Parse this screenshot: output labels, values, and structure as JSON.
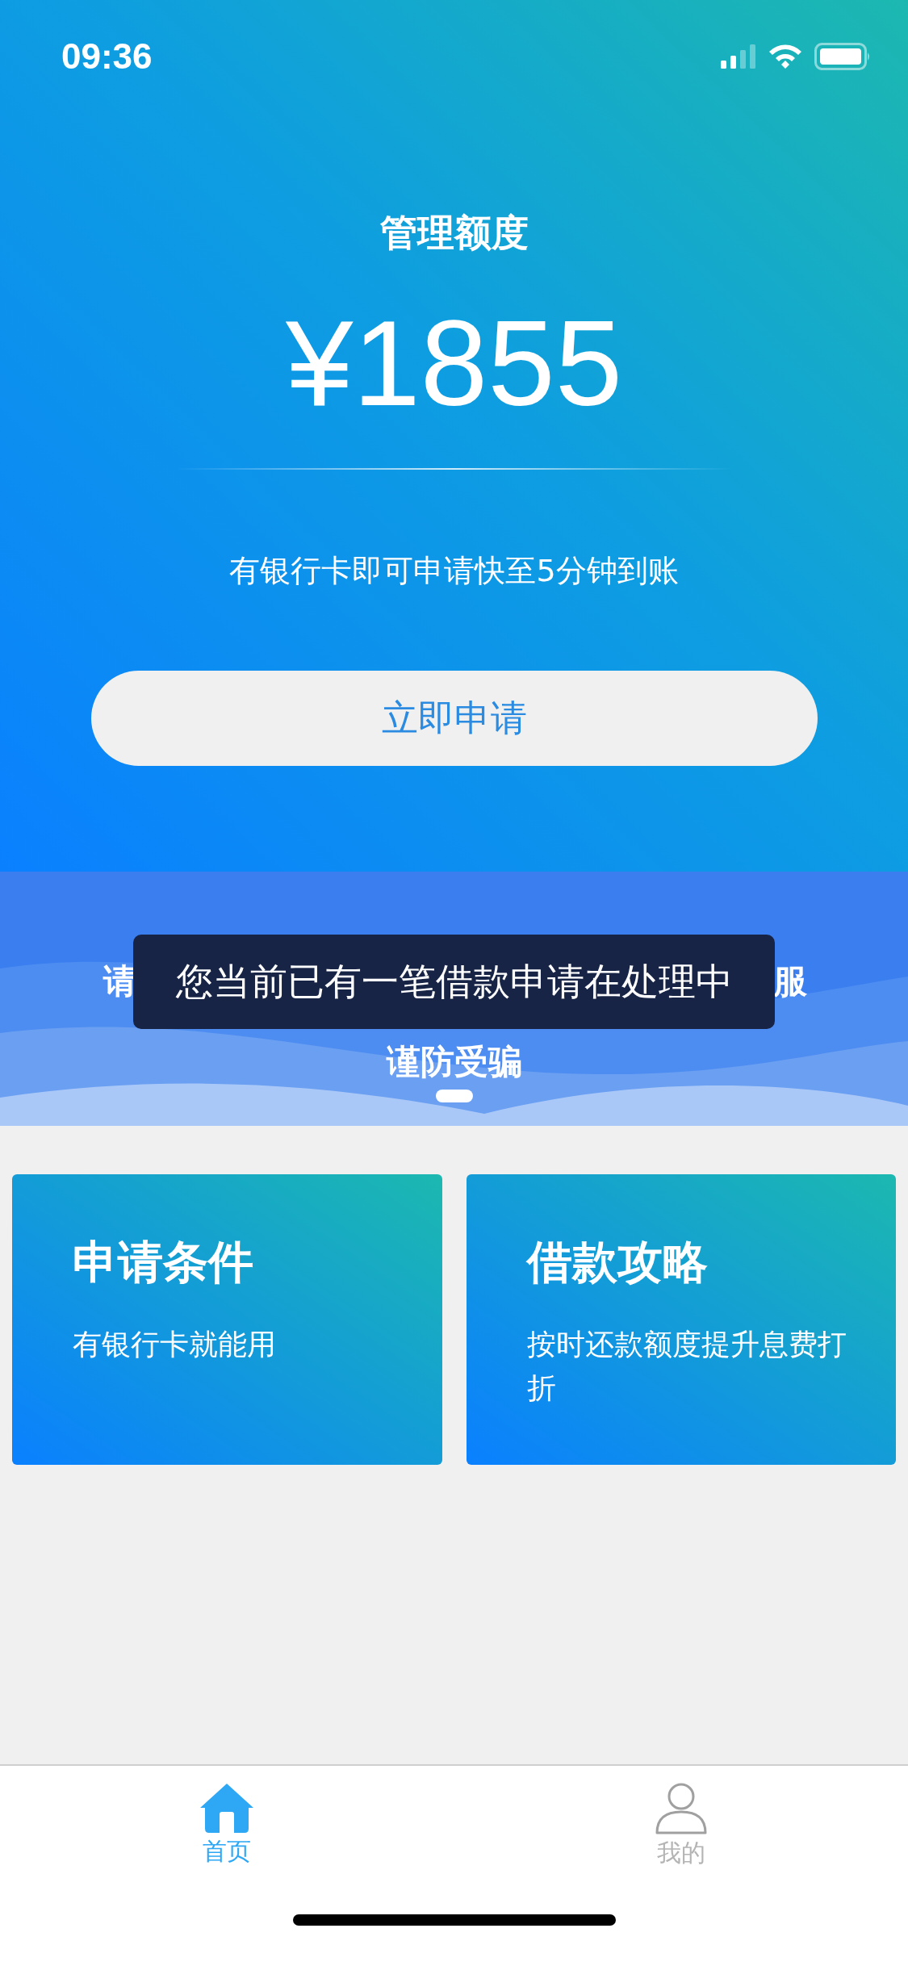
{
  "status_bar": {
    "time": "09:36"
  },
  "header": {
    "title": "管理额度",
    "amount": "¥1855",
    "subtitle": "有银行卡即可申请快至5分钟到账",
    "apply_button": "立即申请"
  },
  "banner": {
    "line_left": "请",
    "line_right": "服",
    "line_2": "谨防受骗"
  },
  "toast": "您当前已有一笔借款申请在处理中",
  "cards": [
    {
      "title": "申请条件",
      "description": "有银行卡就能用"
    },
    {
      "title": "借款攻略",
      "description": "按时还款额度提升息费打折"
    }
  ],
  "tab_bar": [
    {
      "label": "首页",
      "kind": "home",
      "selected": true
    },
    {
      "label": "我的",
      "kind": "profile",
      "selected": false
    }
  ]
}
